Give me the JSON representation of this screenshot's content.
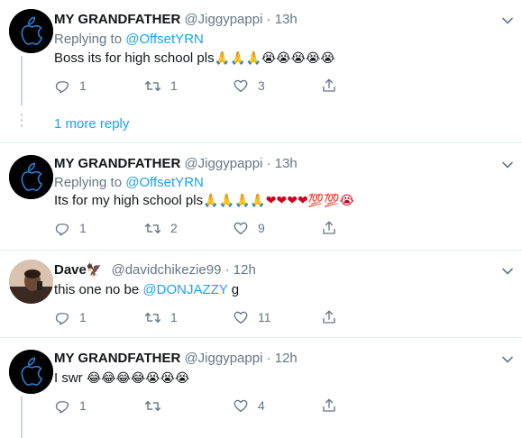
{
  "tweets": [
    {
      "name": "MY GRANDFATHER",
      "handle": "@Jiggypappi",
      "sep": "·",
      "time": "13h",
      "replying_label": "Replying to",
      "replying_to": "@OffsetYRN",
      "text": "Boss its for high school pls",
      "emojis": "🙏🙏🙏😭😭😭😭😭",
      "replies": "1",
      "retweets": "1",
      "likes": "3"
    },
    {
      "name": "MY GRANDFATHER",
      "handle": "@Jiggypappi",
      "sep": "·",
      "time": "13h",
      "replying_label": "Replying to",
      "replying_to": "@OffsetYRN",
      "text": "Its for my high school pls",
      "emojis": "🙏🙏🙏🙏❤❤❤❤💯💯😭",
      "replies": "1",
      "retweets": "2",
      "likes": "9"
    },
    {
      "name": "Dave",
      "name_emoji": "🦅",
      "handle": "@davidchikezie99",
      "sep": "·",
      "time": "12h",
      "text": "this one no be ",
      "mention": "@DONJAZZY",
      "text_after": " g",
      "replies": "1",
      "retweets": "1",
      "likes": "11"
    },
    {
      "name": "MY GRANDFATHER",
      "handle": "@Jiggypappi",
      "sep": "·",
      "time": "12h",
      "text": "I swr ",
      "emojis": "😂😂😂😂😭😭😭",
      "replies": "1",
      "retweets": "",
      "likes": "4"
    }
  ],
  "more_reply": "1 more reply",
  "icons": [
    "reply-icon",
    "retweet-icon",
    "like-icon",
    "share-icon",
    "chevron-down-icon"
  ],
  "colors": {
    "link": "#1da1f2",
    "muted": "#657786",
    "divider": "#e6ecf0"
  }
}
